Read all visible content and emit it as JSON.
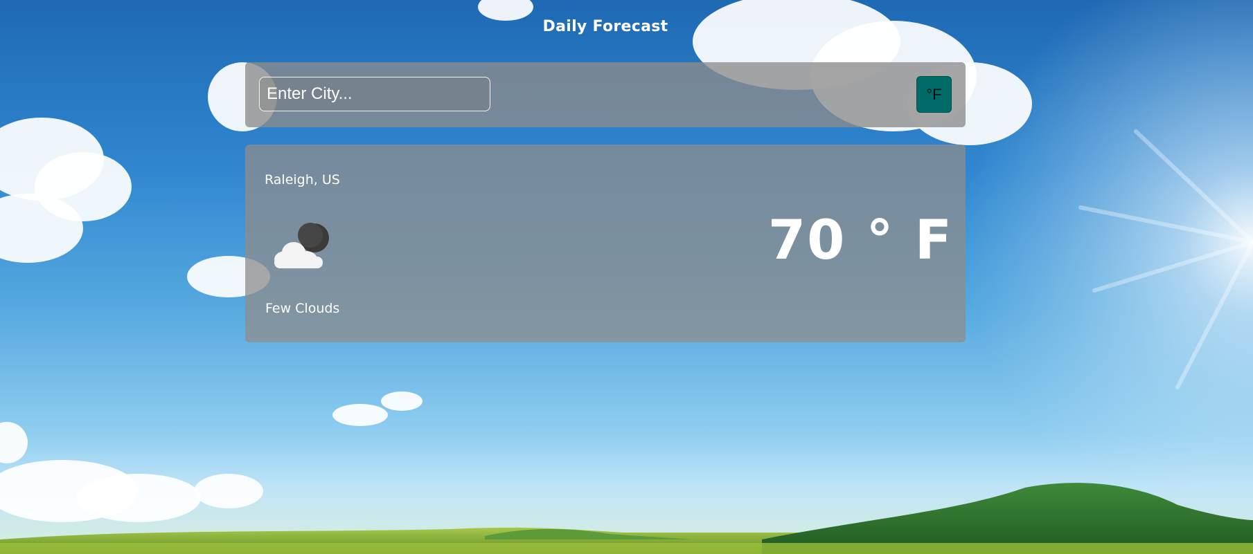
{
  "header": {
    "title": "Daily Forecast"
  },
  "search": {
    "placeholder": "Enter City...",
    "value": ""
  },
  "unit_toggle": {
    "label": "°F"
  },
  "weather": {
    "location": "Raleigh, US",
    "temperature": "70 ° F",
    "description": "Few Clouds",
    "icon": "few-clouds-night-icon"
  },
  "colors": {
    "toggle_bg": "#016b68",
    "panel_bg": "rgba(140,140,140,0.78)"
  }
}
